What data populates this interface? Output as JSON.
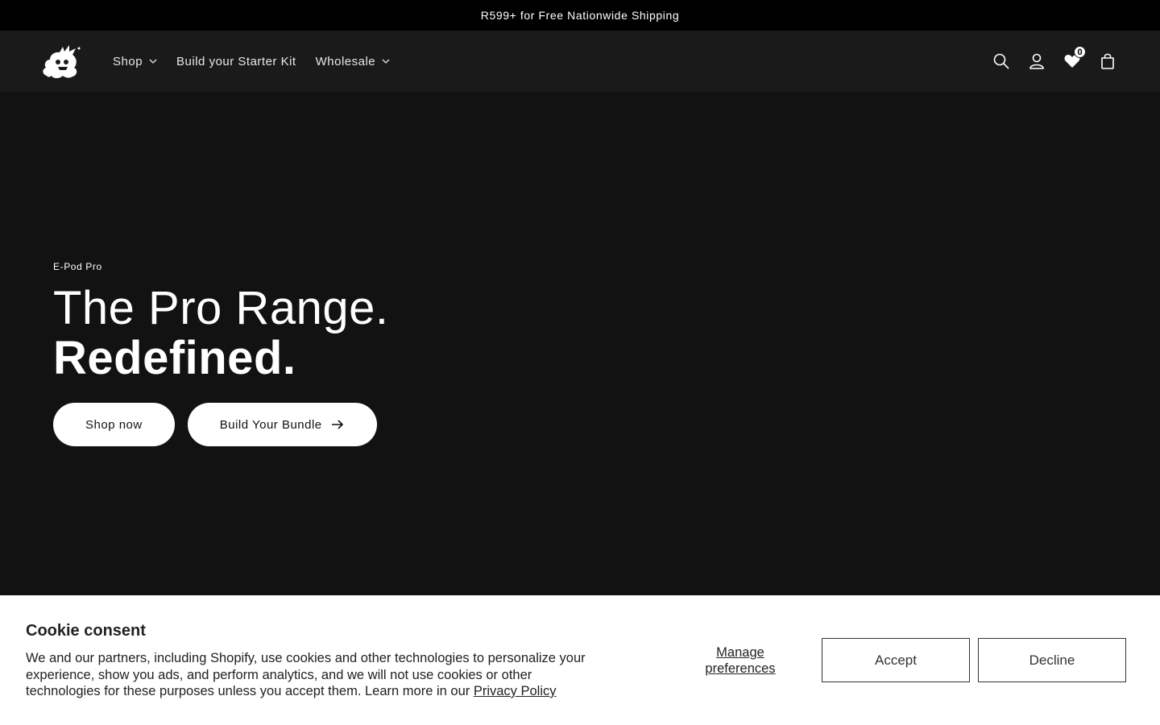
{
  "announcement": {
    "text": "R599+ for Free Nationwide Shipping"
  },
  "header": {
    "logo_icon": "mascot-logo-icon",
    "nav": [
      {
        "label": "Shop",
        "has_dropdown": true
      },
      {
        "label": "Build your Starter Kit",
        "has_dropdown": false
      },
      {
        "label": "Wholesale",
        "has_dropdown": true
      }
    ],
    "icons": {
      "search": "search-icon",
      "account": "user-icon",
      "wishlist": "heart-icon",
      "wishlist_count": "0",
      "cart": "cart-icon"
    }
  },
  "hero": {
    "eyebrow": "E-Pod Pro",
    "heading_line1": "The Pro Range.",
    "heading_line2": "Redefined.",
    "primary_cta": "Shop now",
    "secondary_cta": "Build Your Bundle",
    "secondary_cta_icon": "arrow-right-icon"
  },
  "cookie": {
    "title": "Cookie consent",
    "body": "We and our partners, including Shopify, use cookies and other technologies to personalize your experience, show you ads, and perform analytics, and we will not use cookies or other technologies for these purposes unless you accept them. Learn more in our ",
    "policy_link": "Privacy Policy",
    "manage_label": "Manage preferences",
    "accept_label": "Accept",
    "decline_label": "Decline"
  },
  "colors": {
    "page_bg": "#121212",
    "header_bg": "#1a1a1a",
    "announcement_bg": "#000000",
    "cookie_bg": "#ffffff"
  }
}
